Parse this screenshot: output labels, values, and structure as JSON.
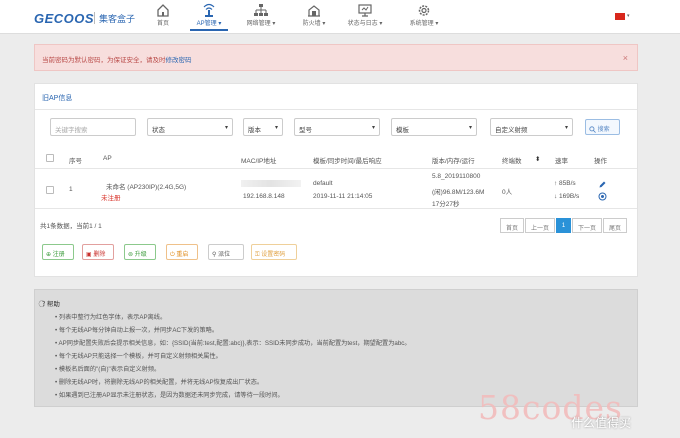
{
  "brand": {
    "logo": "GECOOS",
    "name": "集客盒子"
  },
  "nav": [
    {
      "label": "首页",
      "icon": "home-icon",
      "caret": ""
    },
    {
      "label": "AP管理",
      "icon": "wifi-icon",
      "caret": "▾"
    },
    {
      "label": "网络管理",
      "icon": "network-icon",
      "caret": "▾"
    },
    {
      "label": "防火墙",
      "icon": "firewall-icon",
      "caret": "▾"
    },
    {
      "label": "状态与日志",
      "icon": "monitor-icon",
      "caret": "▾"
    },
    {
      "label": "系统管理",
      "icon": "gear-icon",
      "caret": "▾"
    }
  ],
  "language_caret": "▾",
  "alert": {
    "text": "当前密码为默认密码，为保证安全，请及时",
    "link": "修改密码",
    "close": "×"
  },
  "card_title": "旧AP信息",
  "filters": {
    "keyword_placeholder": "关键字搜索",
    "status": "状态",
    "version": "版本",
    "model": "型号",
    "template": "模板",
    "custom_mode": "自定义射频",
    "search": "搜索"
  },
  "caret": "▾",
  "table": {
    "headers": [
      "序号",
      "AP",
      "MAC/IP地址",
      "模板/同步时间/最后响应",
      "版本/内存/运行",
      "终端数",
      "速率",
      "操作"
    ],
    "sort_icon": "⬍",
    "row": {
      "index": "1",
      "name": "未命名 (AP230IP)(2.4G,5G)",
      "status": "未注册",
      "ip": "192.168.8.148",
      "template": "default",
      "time": "2019-11-11 21:14:05",
      "version": "5.8_2019110800",
      "memory": "(闲)96.8M/123.6M",
      "uptime": "17分27秒",
      "clients": "0人",
      "rate_up": "↑ 85B/s",
      "rate_down": "↓ 169B/s"
    }
  },
  "summary": "共1条数据，当前1 / 1",
  "pagination": [
    "首页",
    "上一页",
    "1",
    "下一页",
    "尾页"
  ],
  "actions": [
    "注册",
    "删除",
    "升级",
    "重启",
    "派位",
    "设置密码"
  ],
  "help": {
    "title": "帮助",
    "items": [
      "列表中整行为红色字体，表示AP离线。",
      "每个无线AP每分钟自动上报一次，并同步AC下发的策略。",
      "AP同步配置失败后会提示相关信息，如：{SSID(当前:test,配置:abc)},表示：SSID未同步成功，当前配置为test，期望配置为abc。",
      "每个无线AP只能选择一个模板，并可自定义射频相关属性。",
      "模板名后面的\"(自)\"表示自定义射频。",
      "删除无线AP时，将删除无线AP的相关配置，并将无线AP恢复成出厂状态。",
      "如果遇到已注册AP显示未注册状态，是因为数据还未同步完成，请等待一段时间。"
    ]
  },
  "watermark": {
    "text": "58codes",
    "site": "什么值得买"
  },
  "colors": {
    "accent": "#2a66b1",
    "danger": "#d9342b",
    "alert_bg": "#f7dedd"
  }
}
